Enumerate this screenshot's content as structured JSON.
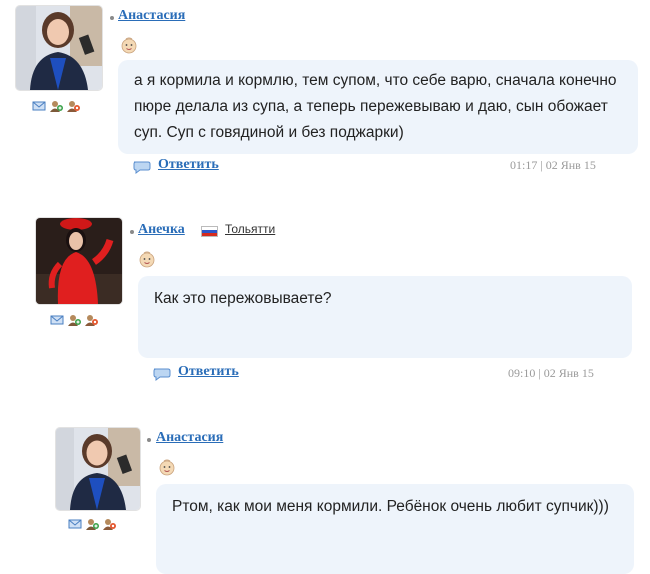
{
  "posts": [
    {
      "author": "Анастасия",
      "text": "а я кормила и кормлю, тем супом, что себе варю, сначала конечно пюре делала из супа, а теперь пережевываю и даю, сын обожает суп. Суп с говядиной и без поджарки)",
      "reply_label": "Ответить",
      "timestamp": "01:17 | 02 Янв 15"
    },
    {
      "author": "Анечка",
      "city": "Тольятти",
      "text": "Как это пережовываете?",
      "reply_label": "Ответить",
      "timestamp": "09:10 | 02 Янв 15"
    },
    {
      "author": "Анастасия",
      "text": "Ртом, как мои меня кормили. Ребёнок очень любит супчик)))"
    }
  ],
  "icons": {
    "message": "envelope-icon",
    "add_friend": "add-friend-icon",
    "gift": "gift-icon",
    "smile": "baby-smile-icon",
    "reply": "speech-bubble-icon"
  },
  "colors": {
    "link": "#2a6db8",
    "bubble": "#eef4fb",
    "meta": "#9a9a9a"
  }
}
